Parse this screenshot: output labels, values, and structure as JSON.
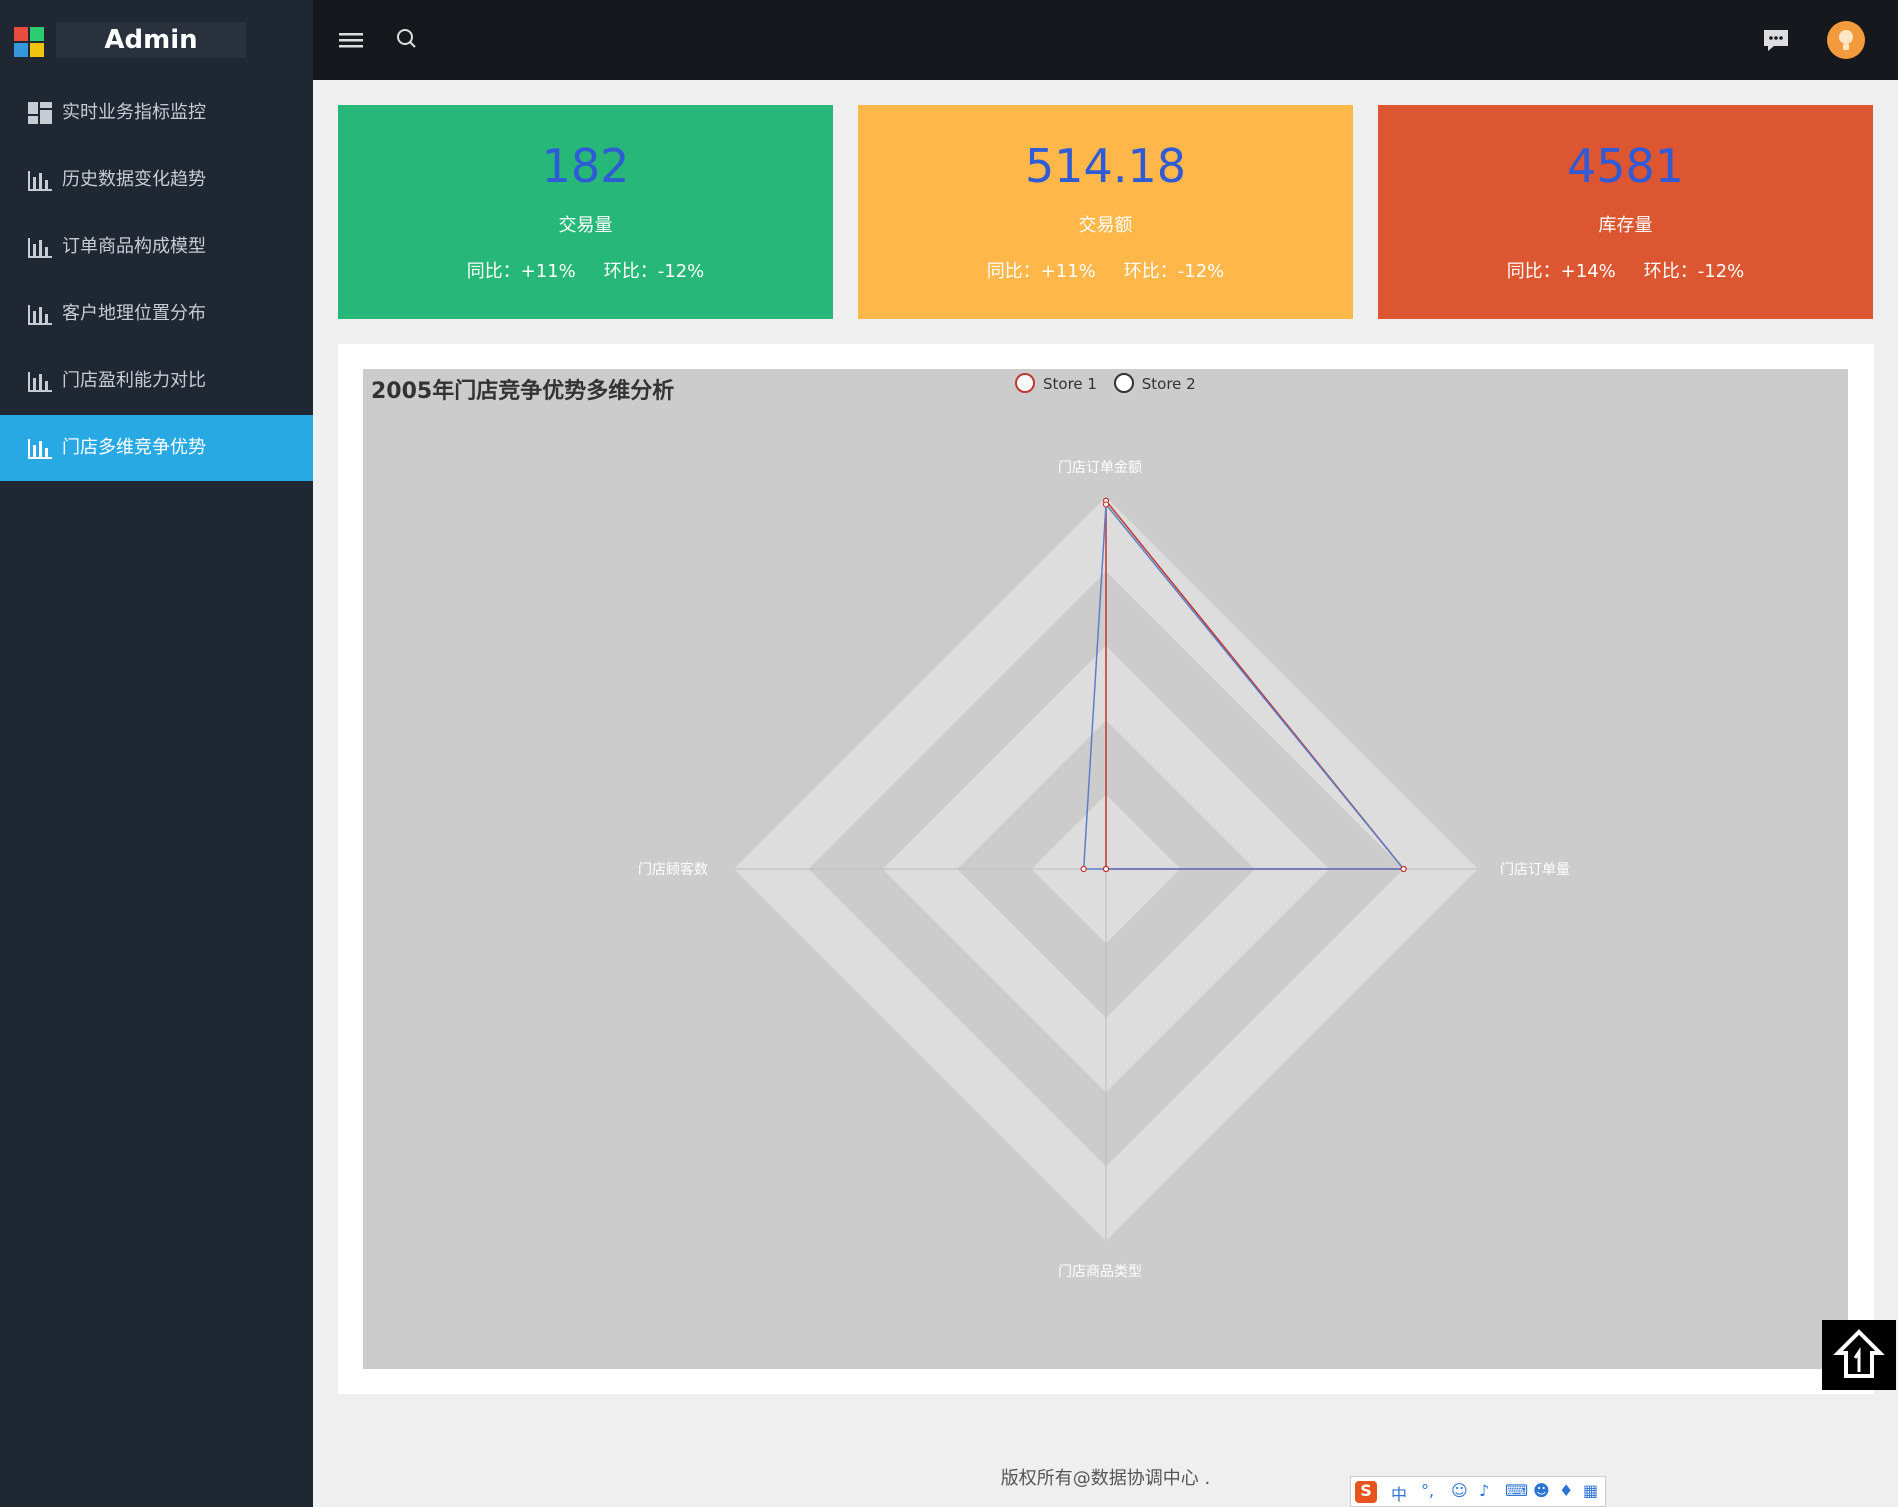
{
  "app": {
    "brand": "Admin"
  },
  "sidebar": {
    "items": [
      {
        "label": "实时业务指标监控",
        "icon": "dashboard-icon"
      },
      {
        "label": "历史数据变化趋势",
        "icon": "bar-chart-icon"
      },
      {
        "label": "订单商品构成模型",
        "icon": "bar-chart-icon"
      },
      {
        "label": "客户地理位置分布",
        "icon": "bar-chart-icon"
      },
      {
        "label": "门店盈利能力对比",
        "icon": "bar-chart-icon"
      },
      {
        "label": "门店多维竞争优势",
        "icon": "bar-chart-icon"
      }
    ],
    "active_index": 5
  },
  "topbar": {
    "menu_icon": "hamburger-icon",
    "search_icon": "search-icon",
    "message_icon": "chat-icon",
    "avatar_icon": "avatar-icon"
  },
  "stats": [
    {
      "value": "182",
      "label": "交易量",
      "yoy": "同比：+11%",
      "mom": "环比：-12%",
      "bg": "#27b778"
    },
    {
      "value": "514.18",
      "label": "交易额",
      "yoy": "同比：+11%",
      "mom": "环比：-12%",
      "bg": "#ffb74a"
    },
    {
      "value": "4581",
      "label": "库存量",
      "yoy": "同比：+14%",
      "mom": "环比：-12%",
      "bg": "#dc5631"
    }
  ],
  "chart_data": {
    "type": "radar",
    "title": "2005年门店竞争优势多维分析",
    "indicators": [
      "门店订单金额",
      "门店订单量",
      "门店商品类型",
      "门店顾客数"
    ],
    "max": [
      5,
      5,
      5,
      5
    ],
    "series": [
      {
        "name": "Store 1",
        "values": [
          4.95,
          4,
          0,
          0
        ],
        "color": "#c23531"
      },
      {
        "name": "Store 2",
        "values": [
          4.9,
          4,
          0,
          0.3
        ],
        "color": "#5b7fc7"
      }
    ],
    "split_number": 5,
    "legend_position": "top-center",
    "colors": {
      "background": "#cccccc",
      "split_light": "#dddddd",
      "split_dark": "#cccccc"
    }
  },
  "footer": {
    "copyright": "版权所有@数据协调中心 ."
  },
  "back_to_top_icon": "arrow-up-icon",
  "ime": {
    "mode": "中",
    "punct": "°,"
  }
}
